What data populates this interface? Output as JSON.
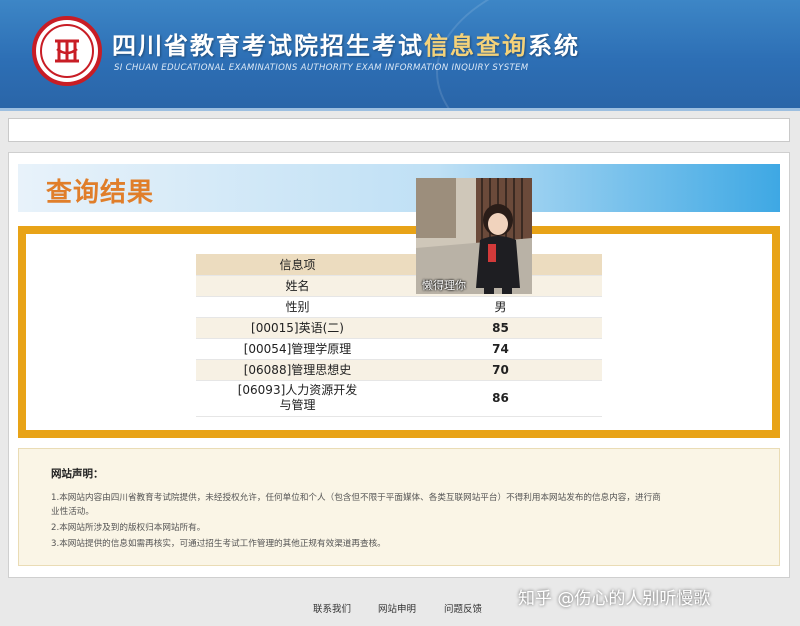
{
  "header": {
    "title_main": "四川省教育考试院招生考试",
    "title_highlight": "信息查询",
    "title_end": "系统",
    "subtitle": "SI CHUAN EDUCATIONAL EXAMINATIONS AUTHORITY EXAM INFORMATION INQUIRY SYSTEM",
    "logo_icon": "exam-authority-seal"
  },
  "result": {
    "title": "查询结果",
    "header_row": {
      "label": "信息项"
    },
    "rows": [
      {
        "label": "姓名",
        "value": ""
      },
      {
        "label": "性别",
        "value": "男"
      },
      {
        "label": "[00015]英语(二)",
        "value": "85"
      },
      {
        "label": "[00054]管理学原理",
        "value": "74"
      },
      {
        "label": "[06088]管理思想史",
        "value": "70"
      },
      {
        "label_line1": "[06093]人力资源开发",
        "label_line2": "与管理",
        "value": "86"
      }
    ]
  },
  "photo": {
    "caption": "懒得理你"
  },
  "disclaimer": {
    "title": "网站声明：",
    "lines": [
      "1.本网站内容由四川省教育考试院提供，未经授权允许，任何单位和个人（包含但不限于平面媒体、各类互联网站平台）不得利用本网站发布的信息内容，进行商",
      "业性活动。",
      "2.本网站所涉及到的版权归本网站所有。",
      "3.本网站提供的信息如需再核实，可通过招生考试工作管理的其他正规有效渠道再查核。"
    ]
  },
  "footer": {
    "links": [
      "联系我们",
      "网站申明",
      "问题反馈"
    ]
  },
  "watermark": "知乎 @伤心的人别听慢歌",
  "colors": {
    "header_blue": "#2d6fb5",
    "accent_orange": "#e8a317",
    "title_orange": "#e07e2a",
    "seal_red": "#c81d25",
    "table_header": "#ecdcbf"
  }
}
